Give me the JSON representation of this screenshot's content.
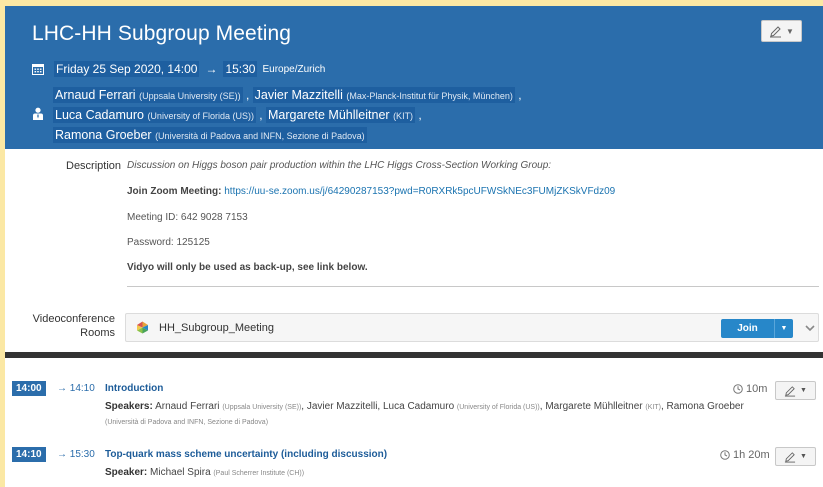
{
  "event": {
    "title": "LHC-HH Subgroup Meeting",
    "date": "Friday 25 Sep 2020, 14:00",
    "arrow": "→",
    "end_time": "15:30",
    "timezone": "Europe/Zurich",
    "chairs": [
      {
        "name": "Arnaud Ferrari",
        "affiliation": "(Uppsala University (SE))",
        "sep": ","
      },
      {
        "name": "Javier Mazzitelli",
        "affiliation": "(Max-Planck-Institut für Physik, München)",
        "sep": ","
      },
      {
        "name": "Luca Cadamuro",
        "affiliation": "(University of Florida (US))",
        "sep": ","
      },
      {
        "name": "Margarete Mühlleitner",
        "affiliation": "(KIT)",
        "sep": ","
      },
      {
        "name": "Ramona Groeber",
        "affiliation": "(Università di Padova and INFN, Sezione di Padova)",
        "sep": ""
      }
    ]
  },
  "description": {
    "label": "Description",
    "text": "Discussion on Higgs boson pair production within the LHC Higgs Cross-Section Working Group:",
    "zoom_label": "Join Zoom Meeting:",
    "zoom_link": "https://uu-se.zoom.us/j/64290287153?pwd=R0RXRk5pcUFWSkNEc3FUMjZKSkVFdz09",
    "meeting_id": "Meeting ID: 642 9028 7153",
    "password": "Password: 125125",
    "vidyo_note": "Vidyo will only be used as back-up, see link below."
  },
  "videoconference": {
    "label_line1": "Videoconference",
    "label_line2": "Rooms",
    "room_name": "HH_Subgroup_Meeting",
    "join_label": "Join"
  },
  "timetable": [
    {
      "start": "14:00",
      "end": "→ 14:10",
      "title": "Introduction",
      "duration": "10m",
      "speakers_label": "Speakers",
      "speakers": [
        {
          "name": "Arnaud Ferrari",
          "affiliation": "(Uppsala University (SE))"
        },
        {
          "name": "Javier Mazzitelli",
          "affiliation": ""
        },
        {
          "name": "Luca Cadamuro",
          "affiliation": "(University of Florida (US))"
        },
        {
          "name": "Margarete Mühlleitner",
          "affiliation": "(KIT)"
        },
        {
          "name": "Ramona Groeber",
          "affiliation": "(Università di Padova and INFN, Sezione di Padova)"
        }
      ]
    },
    {
      "start": "14:10",
      "end": "→ 15:30",
      "title": "Top-quark mass scheme uncertainty (including discussion)",
      "duration": "1h 20m",
      "speakers_label": "Speaker",
      "speakers": [
        {
          "name": "Michael Spira",
          "affiliation": "(Paul Scherrer Institute (CH))"
        }
      ]
    }
  ],
  "colors": {
    "header_bg": "#2b6dab",
    "accent": "#1d5c99",
    "join_button": "#2787c9",
    "page_bg": "#fbe8a4"
  },
  "icons": {
    "calendar": "calendar-icon",
    "person": "person-icon",
    "edit": "pencil-icon",
    "clock": "clock-icon",
    "vidyo": "vidyo-logo-icon",
    "chevron": "chevron-down-icon"
  }
}
